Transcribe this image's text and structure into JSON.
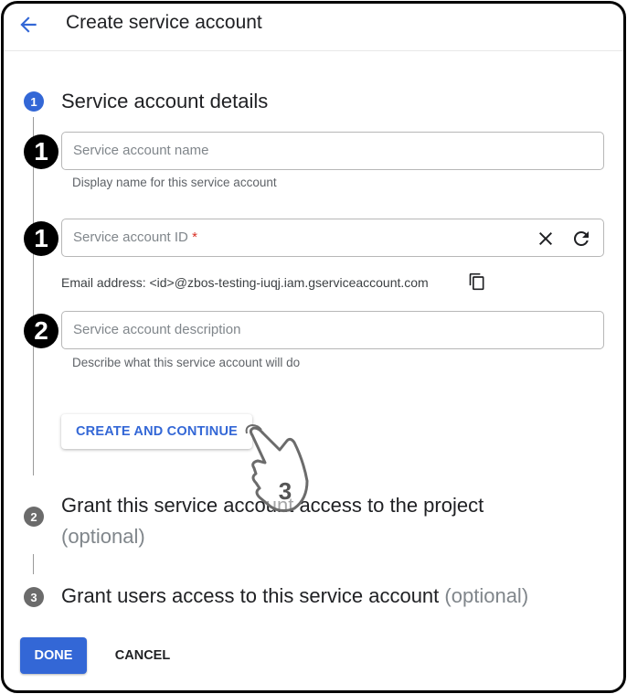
{
  "header": {
    "title": "Create service account",
    "back_icon": "arrow-left-icon"
  },
  "steps": [
    {
      "number": "1",
      "title": "Service account details",
      "optional": "",
      "active": true
    },
    {
      "number": "2",
      "title": "Grant this service account access to the project",
      "optional": "(optional)",
      "active": false
    },
    {
      "number": "3",
      "title": "Grant users access to this service account",
      "optional": "(optional)",
      "active": false
    }
  ],
  "form": {
    "name": {
      "placeholder": "Service account name",
      "value": "",
      "hint": "Display name for this service account",
      "marker": "1"
    },
    "id": {
      "placeholder": "Service account ID",
      "required_mark": "*",
      "value": "",
      "marker": "1",
      "clear_icon": "close-icon",
      "refresh_icon": "refresh-icon"
    },
    "email": {
      "text": "Email address: <id>@zbos-testing-iuqj.iam.gserviceaccount.com",
      "copy_icon": "copy-icon"
    },
    "description": {
      "placeholder": "Service account description",
      "value": "",
      "hint": "Describe what this service account will do",
      "marker": "2"
    },
    "create_button": "CREATE AND CONTINUE"
  },
  "annotation": {
    "hand_label": "3"
  },
  "footer": {
    "done": "DONE",
    "cancel": "CANCEL"
  },
  "colors": {
    "accent": "#3367d6",
    "inactive_step": "#6b6b6b",
    "required": "#d93025"
  }
}
